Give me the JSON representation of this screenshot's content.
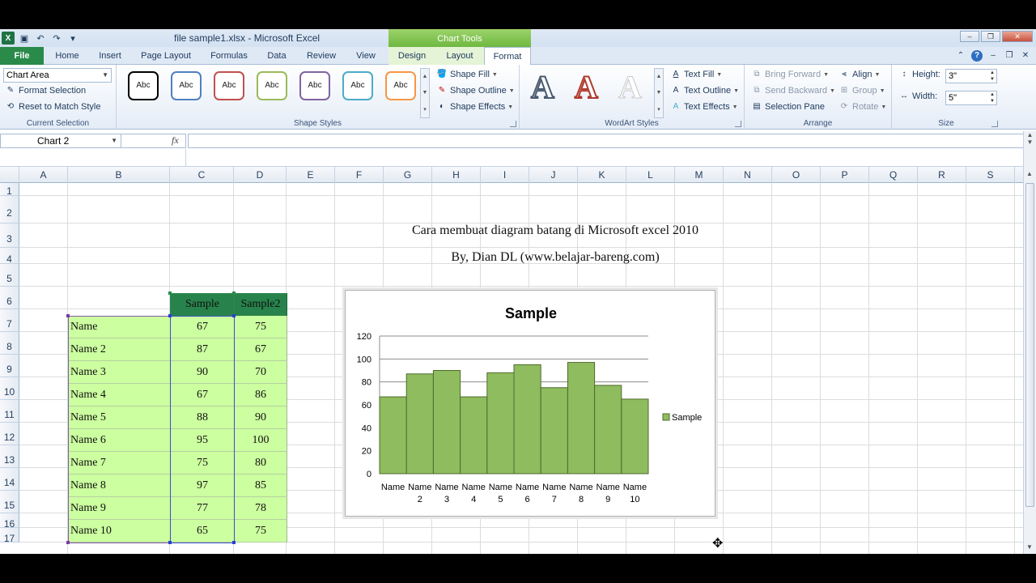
{
  "window": {
    "title": "file sample1.xlsx  -  Microsoft Excel",
    "context_tab_group": "Chart Tools"
  },
  "tabs": [
    "File",
    "Home",
    "Insert",
    "Page Layout",
    "Formulas",
    "Data",
    "Review",
    "View",
    "Design",
    "Layout",
    "Format"
  ],
  "ribbon": {
    "current_selection": {
      "combo_value": "Chart Area",
      "format_selection": "Format Selection",
      "reset_to_match_style": "Reset to Match Style",
      "label": "Current Selection"
    },
    "shape_styles": {
      "swatch_text": "Abc",
      "swatch_colors": [
        "#000000",
        "#4f81bd",
        "#c0504d",
        "#9bbb59",
        "#8064a2",
        "#4bacc6",
        "#f79646"
      ],
      "shape_fill": "Shape Fill",
      "shape_outline": "Shape Outline",
      "shape_effects": "Shape Effects",
      "label": "Shape Styles"
    },
    "wordart_styles": {
      "letter": "A",
      "text_fill": "Text Fill",
      "text_outline": "Text Outline",
      "text_effects": "Text Effects",
      "label": "WordArt Styles"
    },
    "arrange": {
      "bring_forward": "Bring Forward",
      "send_backward": "Send Backward",
      "selection_pane": "Selection Pane",
      "align": "Align",
      "group": "Group",
      "rotate": "Rotate",
      "label": "Arrange"
    },
    "size": {
      "height_label": "Height:",
      "height_value": "3\"",
      "width_label": "Width:",
      "width_value": "5\"",
      "label": "Size"
    }
  },
  "formula_bar": {
    "name_box": "Chart 2",
    "fx": "fx"
  },
  "columns": [
    "A",
    "B",
    "C",
    "D",
    "E",
    "F",
    "G",
    "H",
    "I",
    "J",
    "K",
    "L",
    "M",
    "N",
    "O",
    "P",
    "Q",
    "R",
    "S"
  ],
  "rows": [
    "1",
    "2",
    "3",
    "4",
    "5",
    "6",
    "7",
    "8",
    "9",
    "10",
    "11",
    "12",
    "13",
    "14",
    "15",
    "16",
    "17"
  ],
  "sheet": {
    "caption_line1": "Cara membuat diagram batang di Microsoft excel 2010",
    "caption_line2": "By, Dian DL (www.belajar-bareng.com)",
    "table_headers": [
      "Sample",
      "Sample2"
    ],
    "table_rows": [
      {
        "name": "Name",
        "s1": "67",
        "s2": "75"
      },
      {
        "name": "Name 2",
        "s1": "87",
        "s2": "67"
      },
      {
        "name": "Name 3",
        "s1": "90",
        "s2": "70"
      },
      {
        "name": "Name 4",
        "s1": "67",
        "s2": "86"
      },
      {
        "name": "Name 5",
        "s1": "88",
        "s2": "90"
      },
      {
        "name": "Name 6",
        "s1": "95",
        "s2": "100"
      },
      {
        "name": "Name 7",
        "s1": "75",
        "s2": "80"
      },
      {
        "name": "Name 8",
        "s1": "97",
        "s2": "85"
      },
      {
        "name": "Name 9",
        "s1": "77",
        "s2": "78"
      },
      {
        "name": "Name 10",
        "s1": "65",
        "s2": "75"
      }
    ]
  },
  "chart_data": {
    "type": "bar",
    "title": "Sample",
    "categories": [
      "Name",
      "Name 2",
      "Name 3",
      "Name 4",
      "Name 5",
      "Name 6",
      "Name 7",
      "Name 8",
      "Name 9",
      "Name 10"
    ],
    "series": [
      {
        "name": "Sample",
        "values": [
          67,
          87,
          90,
          67,
          88,
          95,
          75,
          97,
          77,
          65
        ],
        "color": "#8fbc5e"
      }
    ],
    "ylim": [
      0,
      120
    ],
    "yticks": [
      0,
      20,
      40,
      60,
      80,
      100,
      120
    ],
    "grid": true,
    "legend": "right"
  }
}
